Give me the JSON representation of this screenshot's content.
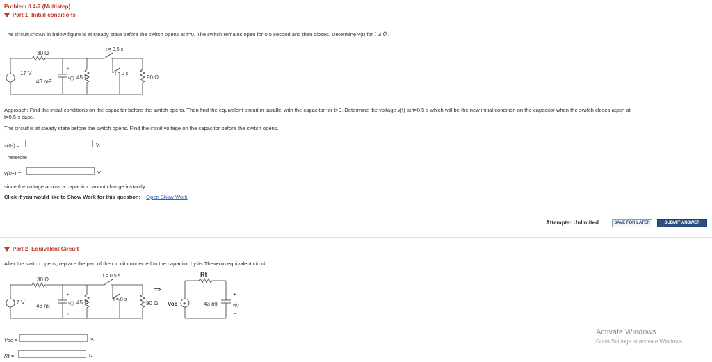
{
  "header": {
    "problem_title": "Problem 8.4-7 (Multistep)",
    "part1_title": "Part 1: Initial conditions"
  },
  "part1": {
    "statement": "The circuit shown in below figure is at steady state before the switch opens at t=0. The switch remains open for 0.5 second and then closes. Determine v(t) for",
    "statement_tail": "t ≥ 0 .",
    "approach_line1": "Approach: Find the initial conditions on the capacitor before the switch opens. Then find the equivalent circuit in parallel with the capacitor for t>0. Determine the voltage v(t) at t=0.5 s which will be the new initial condition on the capacitor when the switch closes again at",
    "approach_line2": "t=0.5 s case.",
    "steady_text": "The circuit is at steady state before the switch opens. Find the initial voltage on the capacitor before the switch opens.",
    "v0minus_label": "v(0-) =",
    "v0minus_value": "",
    "v0minus_unit": "V.",
    "therefore": "Therefore",
    "v0plus_label": "v(0+) =",
    "v0plus_value": "",
    "v0plus_unit": "V.",
    "since_text": "since the voltage across a capacitor cannot change instantly.",
    "show_work_text": "Click if you would like to Show Work for this question:",
    "show_work_link": "Open Show Work"
  },
  "actions": {
    "attempts": "Attempts: Unlimited",
    "save_label": "SAVE FOR LATER",
    "submit_label": "SUBMIT ANSWER"
  },
  "part2": {
    "title": "Part 2: Equivalent Circuit",
    "statement": "After the switch opens, replace the part of the circuit connected to the capacitor by its Thevenin equivalent circuit.",
    "voc_label": "Voc =",
    "voc_value": "",
    "voc_unit": "V.",
    "rt_label": "Rt =",
    "rt_value": "",
    "rt_unit": "Ω"
  },
  "circuit": {
    "r1": "30 Ω",
    "source": "17 V",
    "cap": "43 mF",
    "vt": "v(t)",
    "r2": "45 Ω",
    "r3": "90 Ω",
    "sw_open": "t = 0.5 s",
    "sw_close": "t = 0 s",
    "plus": "+",
    "minus": "−",
    "thev_r": "Rt",
    "thev_v": "Voc",
    "thev_cap": "43 mF",
    "thev_vt": "v(t)",
    "arrow": "⇒"
  },
  "watermark": {
    "line1": "Activate Windows",
    "line2": "Go to Settings to activate Windows."
  }
}
